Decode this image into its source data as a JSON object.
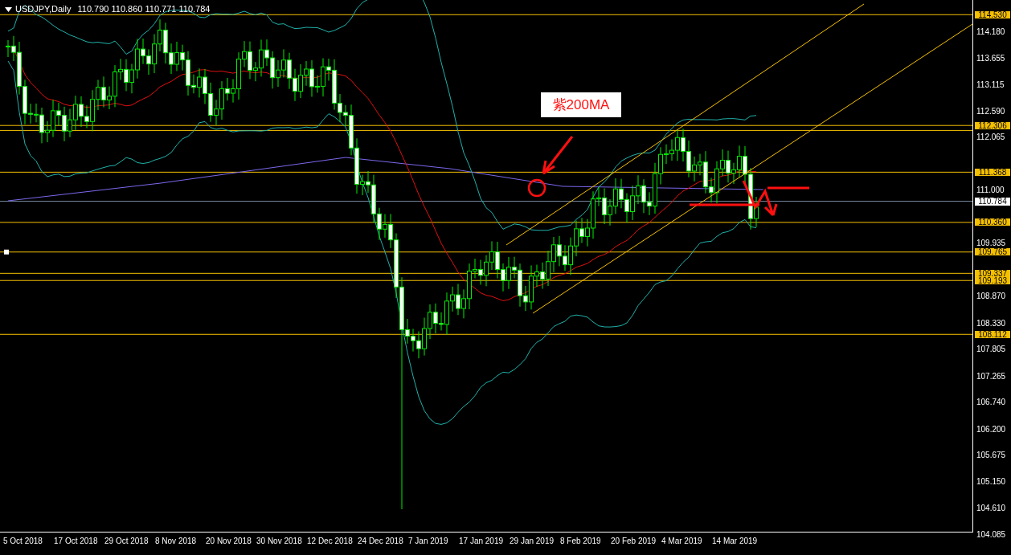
{
  "chart": {
    "symbol": "USDJPY,Daily",
    "ohlc": "110.790 110.860 110.771 110.784"
  },
  "price_axis": {
    "ticks": [
      "114.180",
      "113.655",
      "113.115",
      "112.590",
      "112.065",
      "111.000",
      "109.935",
      "108.870",
      "108.330",
      "107.805",
      "107.265",
      "106.740",
      "106.200",
      "105.675",
      "105.150",
      "104.610",
      "104.085"
    ],
    "current_price": "110.784"
  },
  "levels": [
    {
      "label": "114.530"
    },
    {
      "label": "112.306"
    },
    {
      "label": "111.368"
    },
    {
      "label": "110.360"
    },
    {
      "label": "109.765"
    },
    {
      "label": "109.337"
    },
    {
      "label": "109.193"
    },
    {
      "label": "108.112"
    }
  ],
  "time_axis": {
    "labels": [
      "5 Oct 2018",
      "17 Oct 2018",
      "29 Oct 2018",
      "8 Nov 2018",
      "20 Nov 2018",
      "30 Nov 2018",
      "12 Dec 2018",
      "24 Dec 2018",
      "7 Jan 2019",
      "17 Jan 2019",
      "29 Jan 2019",
      "8 Feb 2019",
      "20 Feb 2019",
      "4 Mar 2019",
      "14 Mar 2019"
    ]
  },
  "annotation": {
    "label": "紫200MA"
  }
}
